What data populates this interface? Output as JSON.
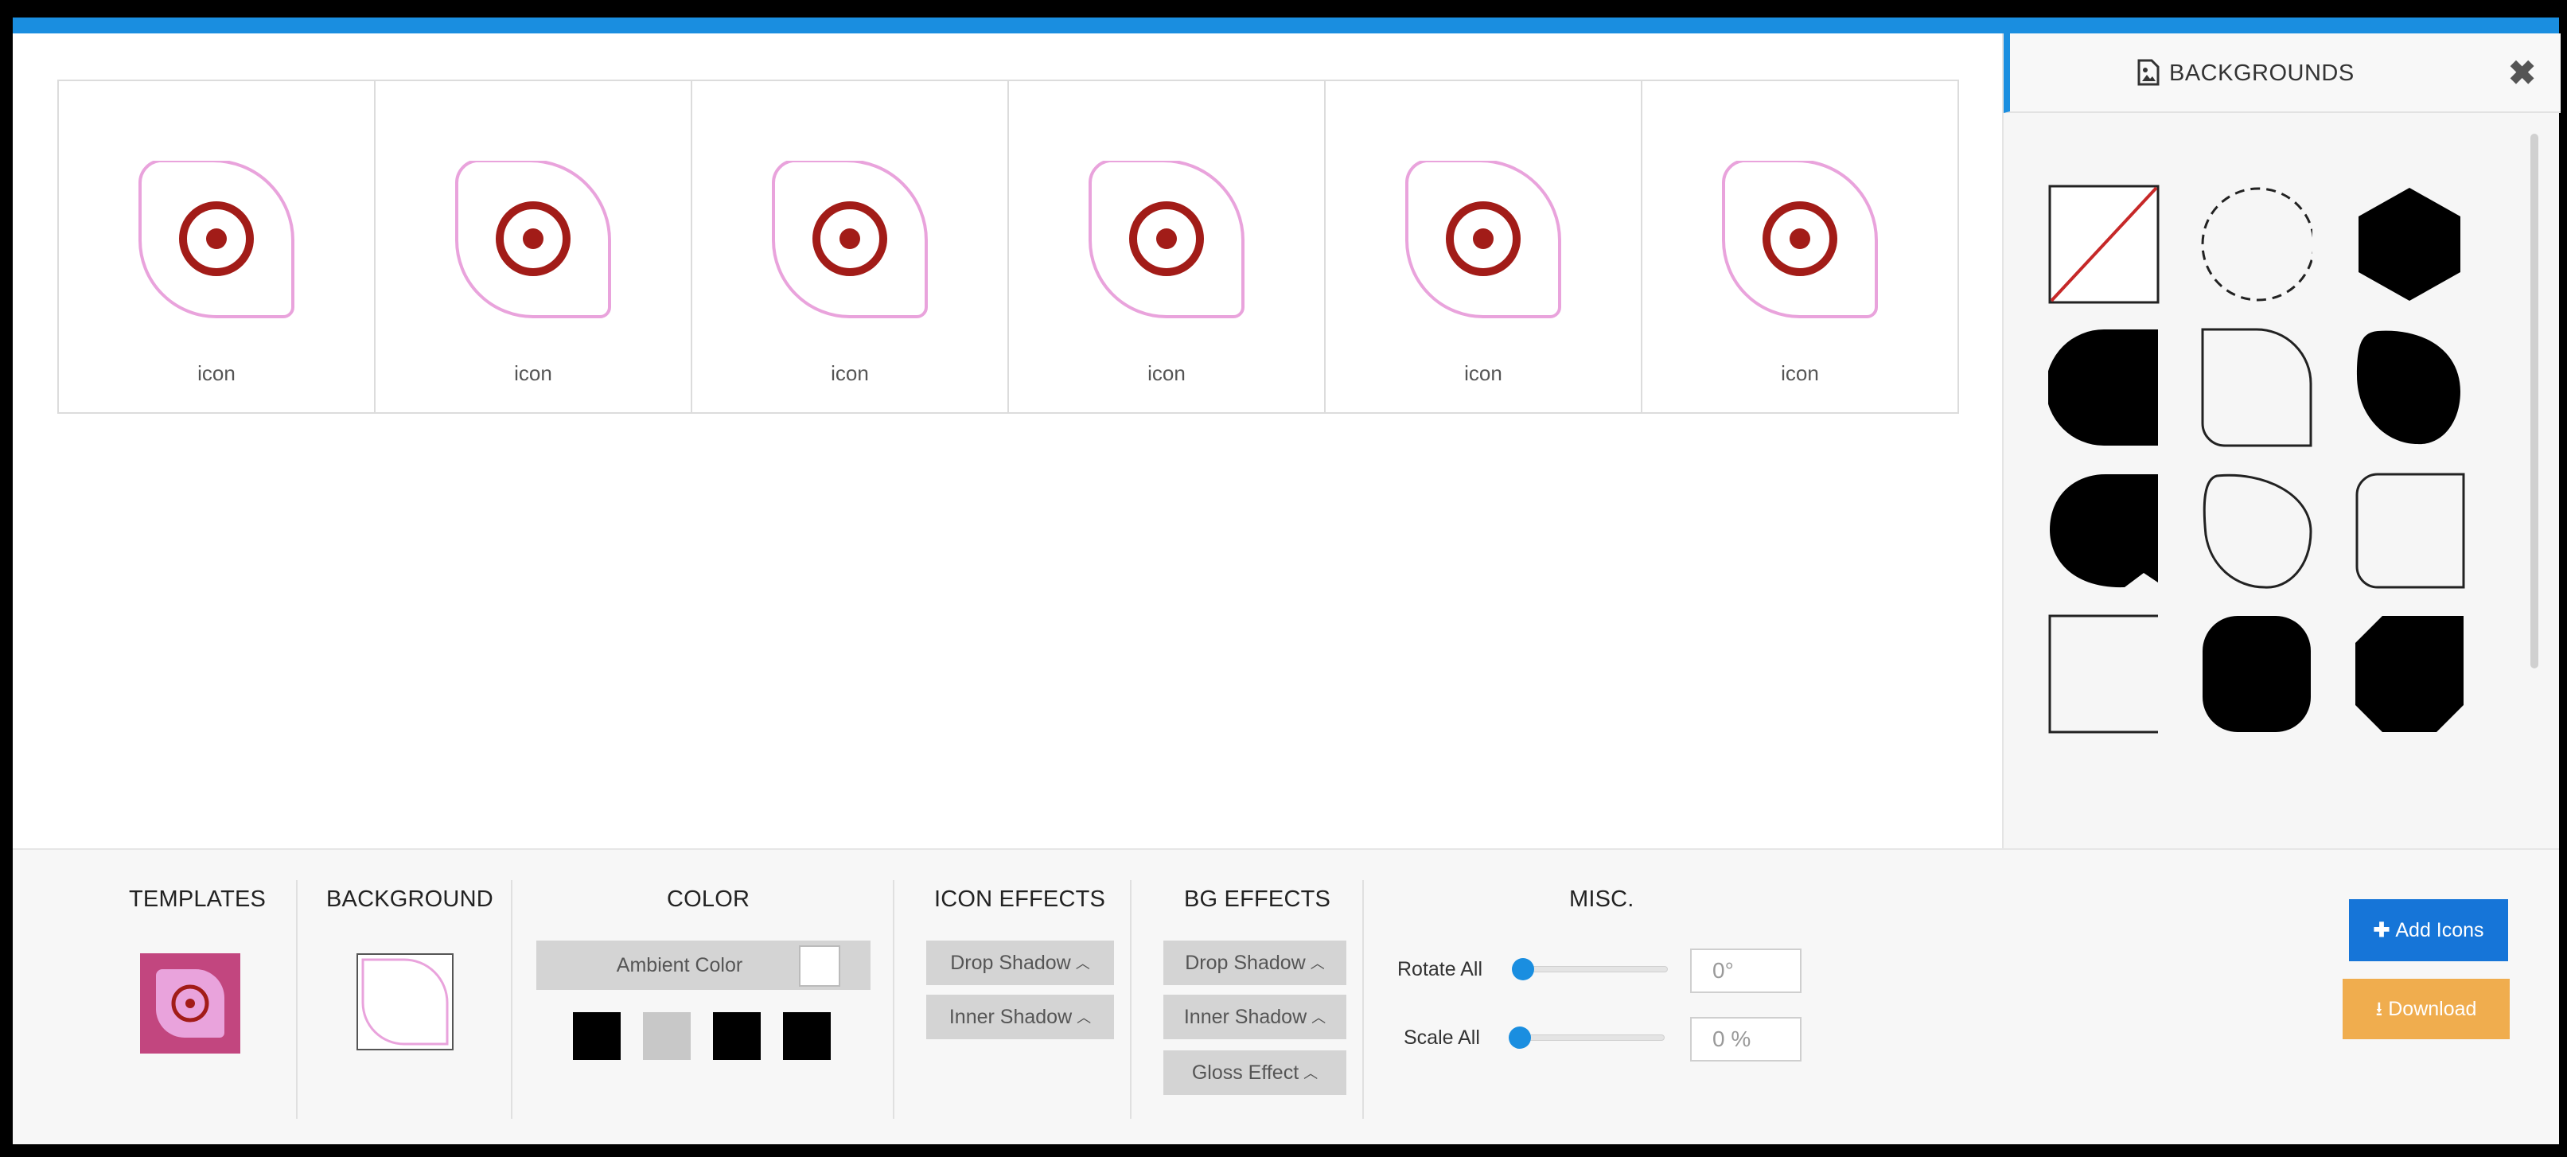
{
  "icons": [
    {
      "label": "icon"
    },
    {
      "label": "icon"
    },
    {
      "label": "icon"
    },
    {
      "label": "icon"
    },
    {
      "label": "icon"
    },
    {
      "label": "icon"
    }
  ],
  "panel": {
    "title": "BACKGROUNDS",
    "close_icon": "close-icon",
    "title_icon": "image-file-icon"
  },
  "bottom": {
    "templates_title": "TEMPLATES",
    "background_title": "BACKGROUND",
    "color_title": "COLOR",
    "ambient_label": "Ambient Color",
    "icon_effects_title": "ICON EFFECTS",
    "icon_drop_shadow": "Drop Shadow",
    "icon_inner_shadow": "Inner Shadow",
    "bg_effects_title": "BG EFFECTS",
    "bg_drop_shadow": "Drop Shadow",
    "bg_inner_shadow": "Inner Shadow",
    "bg_gloss": "Gloss Effect",
    "misc_title": "MISC.",
    "rotate_label": "Rotate All",
    "rotate_value": "0°",
    "scale_label": "Scale All",
    "scale_value": "0 %",
    "add_icons": "Add Icons",
    "download": "Download",
    "rotate_level": 0,
    "scale_level": 0
  },
  "colors": {
    "accent": "#1a8ee0",
    "icon_stroke": "#e9a3dc",
    "icon_glyph": "#a21c18",
    "template_bg": "#c2467f",
    "template_fg": "#e9a3dc",
    "swatches": [
      "#000000",
      "#c8c8c8",
      "#000000",
      "#000000"
    ],
    "ambient": "#ffffff",
    "add_btn": "#1675d8",
    "download_btn": "#f0ad4e"
  }
}
